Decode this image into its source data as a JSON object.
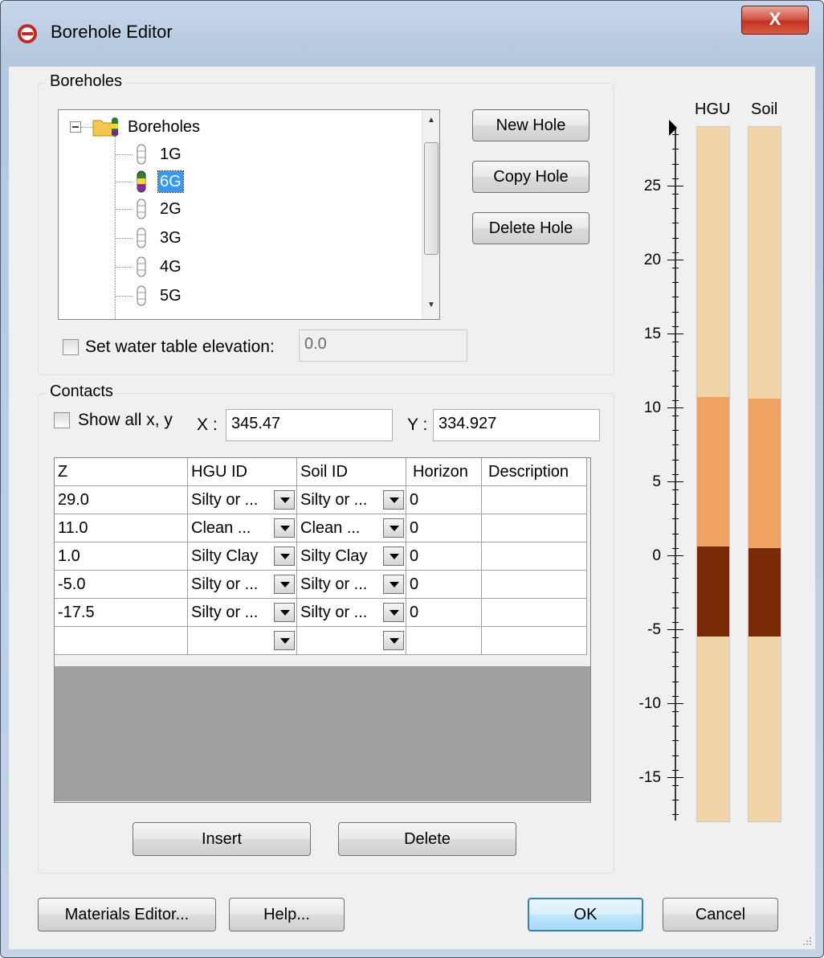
{
  "window": {
    "title": "Borehole Editor",
    "close_label": "X"
  },
  "boreholes": {
    "group_label": "Boreholes",
    "tree_root": "Boreholes",
    "items": [
      "1G",
      "6G",
      "2G",
      "3G",
      "4G",
      "5G"
    ],
    "selected": "6G",
    "buttons": {
      "new": "New Hole",
      "copy": "Copy Hole",
      "delete": "Delete Hole"
    },
    "water_table_label": "Set water table elevation:",
    "water_table_checked": false,
    "water_table_value": "0.0"
  },
  "contacts": {
    "group_label": "Contacts",
    "show_all_label": "Show all x, y",
    "show_all_checked": false,
    "x_label": "X :",
    "x_value": "345.47",
    "y_label": "Y :",
    "y_value": "334.927",
    "columns": [
      "Z",
      "HGU ID",
      "Soil ID",
      "Horizon",
      "Description"
    ],
    "rows": [
      {
        "z": "29.0",
        "hgu": "Silty or ...",
        "soil": "Silty or ...",
        "horizon": "0",
        "description": ""
      },
      {
        "z": "11.0",
        "hgu": "Clean ...",
        "soil": "Clean ...",
        "horizon": "0",
        "description": ""
      },
      {
        "z": "1.0",
        "hgu": "Silty Clay",
        "soil": "Silty Clay",
        "horizon": "0",
        "description": ""
      },
      {
        "z": "-5.0",
        "hgu": "Silty or ...",
        "soil": "Silty or ...",
        "horizon": "0",
        "description": ""
      },
      {
        "z": "-17.5",
        "hgu": "Silty or ...",
        "soil": "Silty or ...",
        "horizon": "0",
        "description": ""
      },
      {
        "z": "",
        "hgu": "",
        "soil": "",
        "horizon": "",
        "description": ""
      }
    ],
    "insert_label": "Insert",
    "delete_label": "Delete"
  },
  "column_view": {
    "hgu_label": "HGU",
    "soil_label": "Soil",
    "axis_ticks": [
      "25",
      "20",
      "15",
      "10",
      "5",
      "0",
      "-5",
      "-10",
      "-15"
    ],
    "layer_colors": {
      "silty_or": "#f0d5a8",
      "clean": "#f0a263",
      "silty_clay": "#7a2a06"
    }
  },
  "footer": {
    "materials_label": "Materials Editor...",
    "help_label": "Help...",
    "ok_label": "OK",
    "cancel_label": "Cancel"
  }
}
